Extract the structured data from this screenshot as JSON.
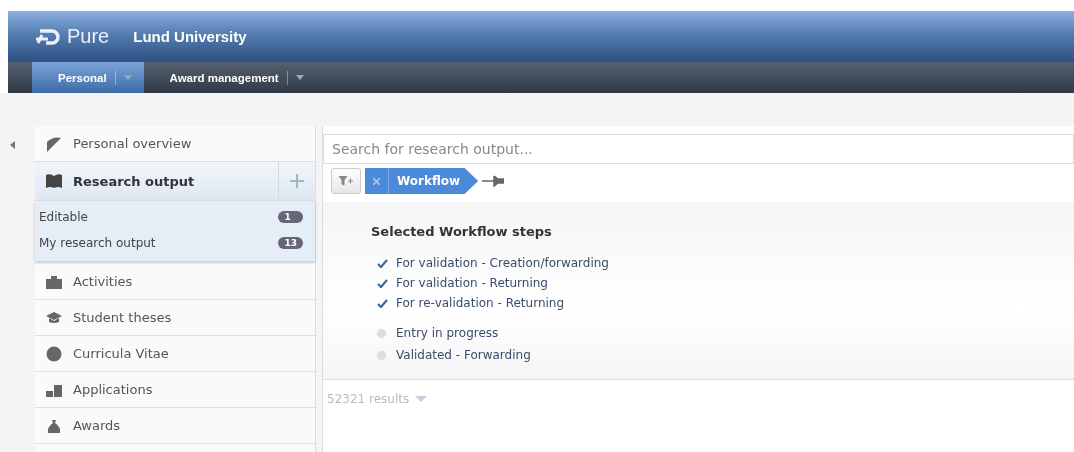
{
  "header": {
    "product": "Pure",
    "organization": "Lund University"
  },
  "nav_tabs": [
    {
      "label": "Personal",
      "selected": true
    },
    {
      "label": "Award management",
      "selected": false
    }
  ],
  "sidebar": {
    "items": [
      {
        "label": "Personal overview",
        "selected": false
      },
      {
        "label": "Research output",
        "selected": true,
        "expanded": true,
        "children": [
          {
            "label": "Editable",
            "count": "1"
          },
          {
            "label": "My research output",
            "count": "13"
          }
        ]
      },
      {
        "label": "Activities",
        "selected": false
      },
      {
        "label": "Student theses",
        "selected": false
      },
      {
        "label": "Curricula Vitae",
        "selected": false
      },
      {
        "label": "Applications",
        "selected": false
      },
      {
        "label": "Awards",
        "selected": false
      }
    ]
  },
  "search": {
    "placeholder": "Search for research output..."
  },
  "filter": {
    "label": "Workflow"
  },
  "workflow_panel": {
    "title": "Selected Workflow steps",
    "steps": [
      {
        "label": "For validation - Creation/forwarding",
        "checked": true
      },
      {
        "label": "For validation - Returning",
        "checked": true
      },
      {
        "label": "For re-validation - Returning",
        "checked": true
      },
      {
        "label": "Entry in progress",
        "checked": false
      },
      {
        "label": "Validated - Forwarding",
        "checked": false
      }
    ]
  },
  "results": {
    "count": "52321 results"
  }
}
